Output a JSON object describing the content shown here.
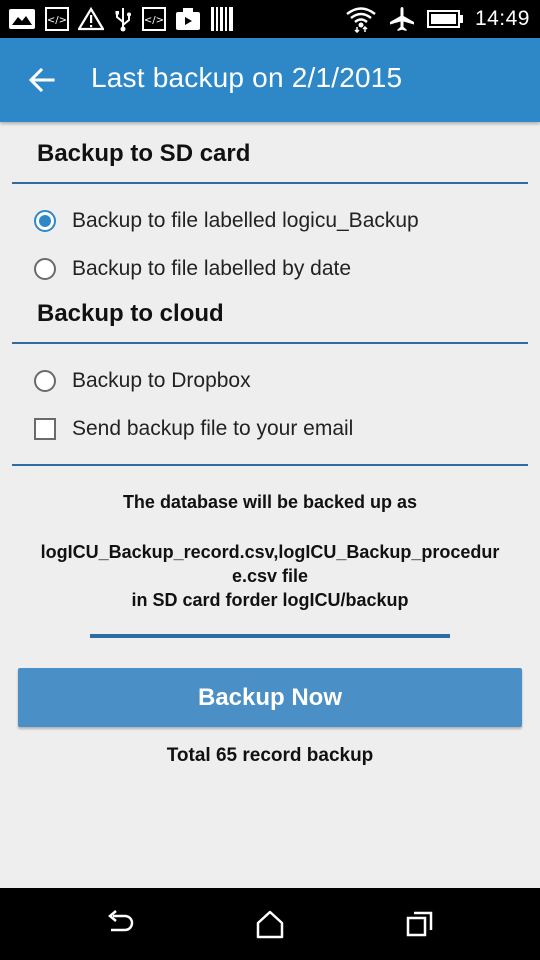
{
  "status_bar": {
    "time": "14:49",
    "left_icons": [
      "image-icon",
      "code-icon",
      "warning-icon",
      "usb-icon",
      "code-icon",
      "video-icon",
      "barcode-icon"
    ],
    "right_icons": [
      "wifi-icon",
      "airplane-icon",
      "battery-icon"
    ]
  },
  "appbar": {
    "title": "Last backup on 2/1/2015",
    "accent": "#2e88c8"
  },
  "sd_section": {
    "title": "Backup to SD card",
    "options": [
      {
        "label": "Backup to file labelled logicu_Backup",
        "checked": true
      },
      {
        "label": "Backup to file labelled by date",
        "checked": false
      }
    ]
  },
  "cloud_section": {
    "title": "Backup to cloud",
    "dropbox_label": "Backup to Dropbox",
    "email_label": "Send backup file to your email"
  },
  "info": {
    "line1": "The database will be backed up as",
    "line2": "logICU_Backup_record.csv,logICU_Backup_procedur",
    "line3": "e.csv file",
    "line4": "in SD card forder logICU/backup"
  },
  "progress": {
    "value": 1.0
  },
  "backup_button_label": "Backup Now",
  "total_text": "Total 65 record backup",
  "nav_icons": [
    "back-nav-icon",
    "home-nav-icon",
    "recents-nav-icon"
  ]
}
